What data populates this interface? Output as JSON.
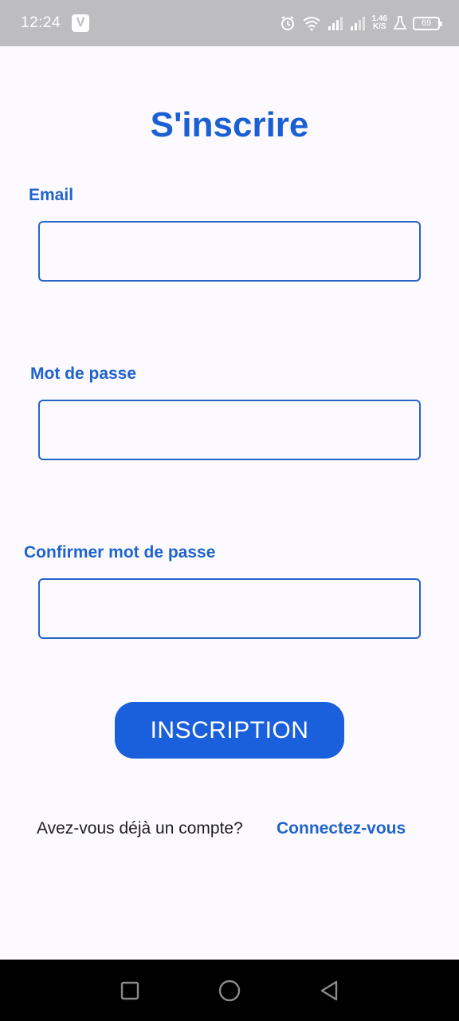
{
  "status_bar": {
    "time": "12:24",
    "app_badge": "V",
    "net_speed_value": "1.46",
    "net_speed_unit": "K/S",
    "battery_level": "69"
  },
  "page": {
    "title": "S'inscrire"
  },
  "form": {
    "email_label": "Email",
    "email_value": "",
    "password_label": "Mot de passe",
    "password_value": "",
    "confirm_label": "Confirmer mot de passe",
    "confirm_value": "",
    "submit_label": "INSCRIPTION"
  },
  "footer": {
    "prompt_text": "Avez-vous déjà un compte?",
    "login_link": "Connectez-vous"
  },
  "colors": {
    "accent": "#1a5fdc",
    "label": "#1f63cc",
    "background": "#fcfaff",
    "status_bar": "#bdbdbf",
    "nav_bar": "#000000"
  },
  "icons": {
    "status": [
      "alarm-icon",
      "wifi-icon",
      "signal-icon",
      "signal-icon",
      "lab-icon",
      "battery-icon"
    ],
    "nav": [
      "recents-icon",
      "home-icon",
      "back-icon"
    ]
  }
}
